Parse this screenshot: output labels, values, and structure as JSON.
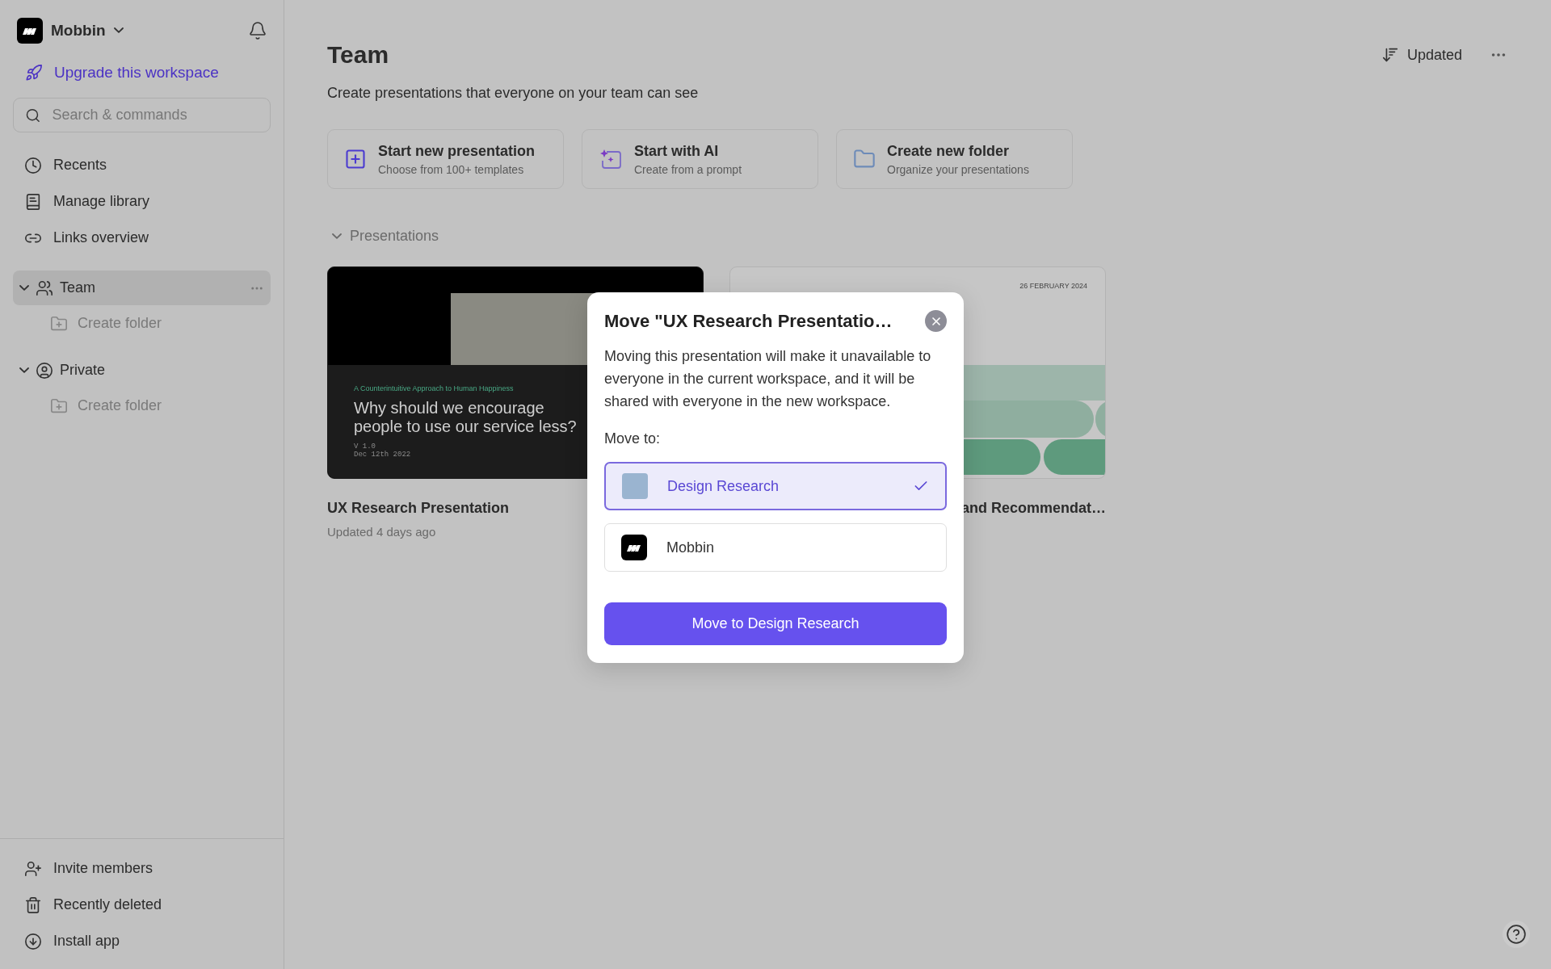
{
  "sidebar": {
    "workspace": "Mobbin",
    "upgrade": "Upgrade this workspace",
    "search": {
      "placeholder": "Search & commands"
    },
    "nav": [
      {
        "label": "Recents"
      },
      {
        "label": "Manage library"
      },
      {
        "label": "Links overview"
      }
    ],
    "sections": [
      {
        "label": "Team",
        "selected": true,
        "expanded": true,
        "children": [
          {
            "label": "Create folder"
          }
        ]
      },
      {
        "label": "Private",
        "selected": false,
        "expanded": true,
        "children": [
          {
            "label": "Create folder"
          }
        ]
      }
    ],
    "footer": [
      {
        "label": "Invite members"
      },
      {
        "label": "Recently deleted"
      },
      {
        "label": "Install app"
      }
    ]
  },
  "header": {
    "title": "Team",
    "subtitle": "Create presentations that everyone on your team can see",
    "sort": "Updated"
  },
  "actions": [
    {
      "title": "Start new presentation",
      "subtitle": "Choose from 100+ templates"
    },
    {
      "title": "Start with AI",
      "subtitle": "Create from a prompt"
    },
    {
      "title": "Create new folder",
      "subtitle": "Organize your presentations"
    }
  ],
  "presentations": {
    "heading": "Presentations",
    "expanded": true,
    "items": [
      {
        "kind": "dark",
        "kicker": "A Counterintuitive Approach to Human Happiness",
        "headline": "Why should we encourage people to use our service less?",
        "version": "V 1.0",
        "date": "Dec 12th 2022",
        "title": "UX Research Presentation",
        "updated": "Updated 4 days ago"
      },
      {
        "kind": "light",
        "date": "26 FEBRUARY 2024",
        "title": "and Recommendat…"
      }
    ]
  },
  "dialog": {
    "title": "Move \"UX Research Presentatio…",
    "body": "Moving this presentation will make it unavailable to everyone in the current workspace, and it will be shared with everyone in the new workspace.",
    "label": "Move to:",
    "options": [
      {
        "kind": "swatch",
        "label": "Design Research",
        "color": "#9ab4d0",
        "selected": true
      },
      {
        "kind": "logo",
        "label": "Mobbin",
        "selected": false
      }
    ],
    "button": "Move to Design Research"
  }
}
